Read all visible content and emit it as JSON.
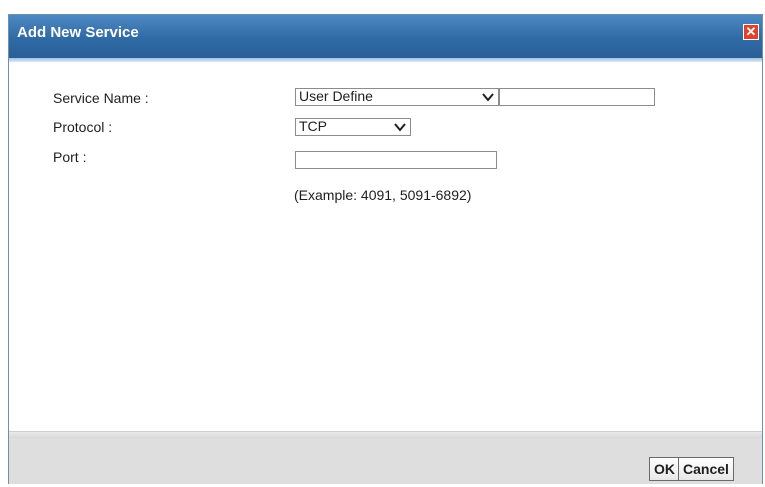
{
  "dialog": {
    "title": "Add New Service",
    "close_symbol": "✕"
  },
  "form": {
    "service_name": {
      "label": "Service Name :",
      "selected": "User Define",
      "custom_value": ""
    },
    "protocol": {
      "label": "Protocol :",
      "selected": "TCP"
    },
    "port": {
      "label": "Port :",
      "value": "",
      "example": "(Example: 4091, 5091-6892)"
    }
  },
  "buttons": {
    "ok_label": "OK",
    "cancel_label": "Cancel"
  },
  "colors": {
    "titlebar": "#2f6aa5",
    "close_button": "#e0412b",
    "footer": "#dedede"
  },
  "icons": {
    "close": "close-icon",
    "dropdown": "chevron-down-icon"
  }
}
